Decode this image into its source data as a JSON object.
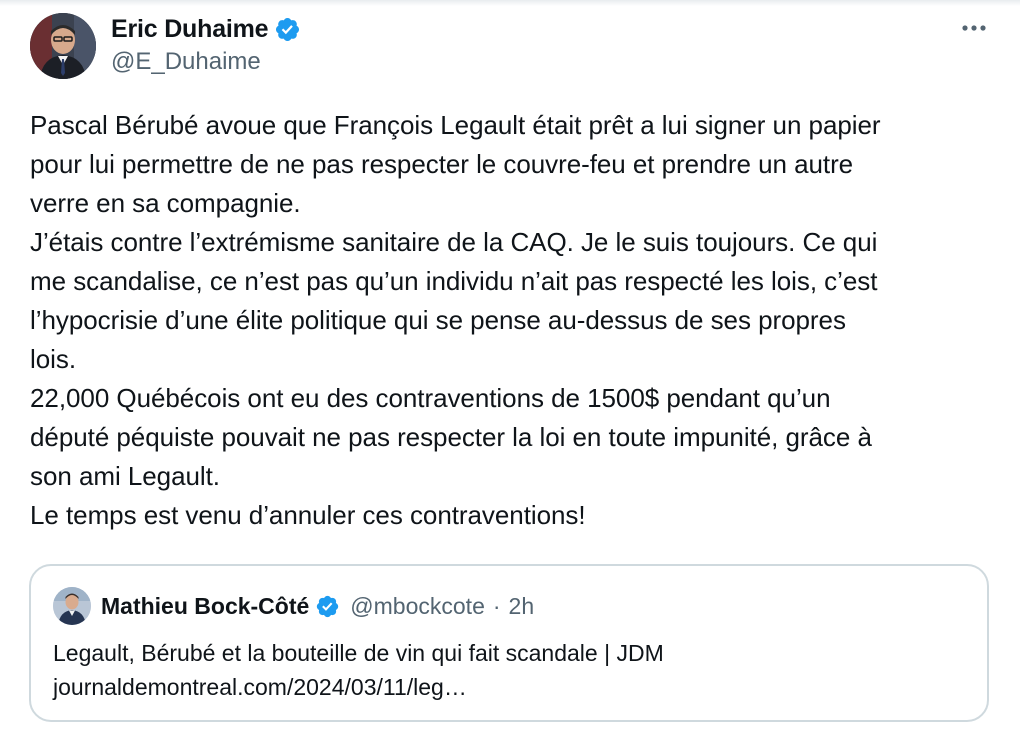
{
  "tweet": {
    "author": {
      "name": "Eric Duhaime",
      "handle": "@E_Duhaime",
      "verified": true,
      "avatar_icon": "profile-photo"
    },
    "text": "Pascal Bérubé avoue que François Legault était prêt a lui signer un papier\npour lui permettre de ne pas respecter le couvre-feu et prendre un autre\nverre en sa compagnie.\nJ’étais contre l’extrémisme sanitaire de la CAQ. Je le suis toujours. Ce qui\nme scandalise, ce n’est pas qu’un individu n’ait pas respecté les lois, c’est\nl’hypocrisie d’une élite politique qui se pense au-dessus de ses propres\nlois.\n22,000 Québécois ont eu des contraventions de 1500$ pendant qu’un\ndéputé péquiste pouvait ne pas respecter la loi en toute impunité, grâce à\nson ami Legault.\nLe temps est venu d’annuler ces contraventions!",
    "more_icon": "more-horizontal-icon"
  },
  "quoted": {
    "author": {
      "name": "Mathieu Bock-Côté",
      "handle": "@mbockcote",
      "separator": "·",
      "time": "2h",
      "verified": true
    },
    "text": "Legault, Bérubé et la bouteille de vin qui fait scandale | JDM\njournaldemontreal.com/2024/03/11/leg…"
  },
  "colors": {
    "text": "#0f1419",
    "secondary": "#536471",
    "verified": "#1d9bf0",
    "border": "#cfd9de"
  }
}
